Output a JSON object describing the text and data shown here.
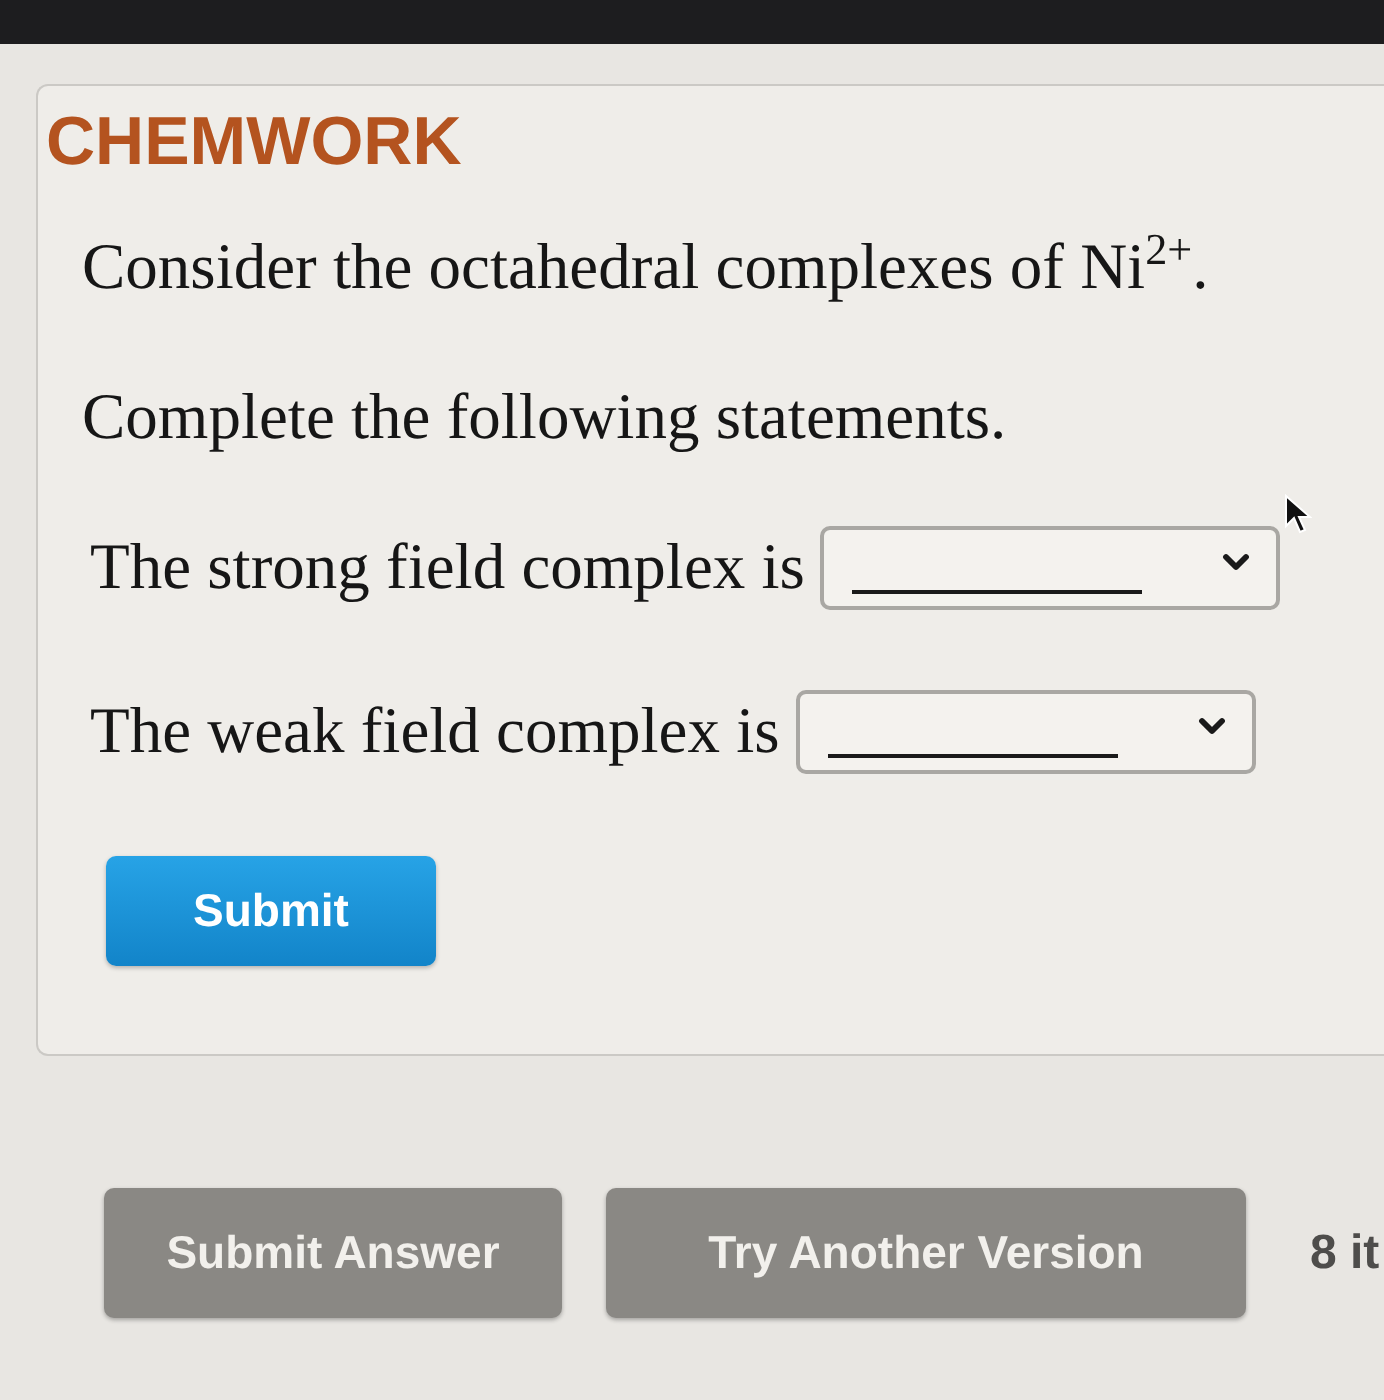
{
  "card": {
    "title": "CHEMWORK",
    "prompt": "Consider the octahedral complexes of Ni$^{2+}$.",
    "instruction": "Complete the following statements.",
    "statements": [
      {
        "label": "The strong field complex is"
      },
      {
        "label": "The weak field complex is"
      }
    ],
    "submit_button": "Submit"
  },
  "footer": {
    "buttons": [
      "Submit Answer",
      "Try Another Version"
    ],
    "trailing_text": "8 it"
  }
}
